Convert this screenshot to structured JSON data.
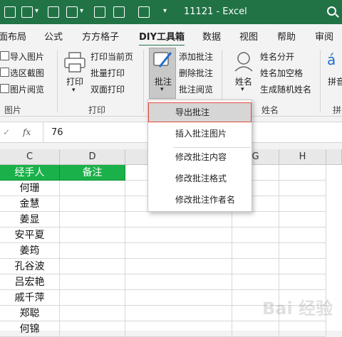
{
  "window": {
    "title": "11121  -  Excel"
  },
  "tabs": [
    "面布局",
    "公式",
    "方方格子",
    "DIY工具箱",
    "数据",
    "视图",
    "帮助",
    "审阅"
  ],
  "ribbon": {
    "picture_group": {
      "items": [
        "导入图片",
        "选区截图",
        "图片阅览"
      ],
      "label": "图片"
    },
    "print_group": {
      "big_label": "打印",
      "items": [
        "打印当前页",
        "批量打印",
        "双面打印"
      ],
      "label": "打印"
    },
    "comment_group": {
      "big_label": "批注",
      "items": [
        "添加批注",
        "删除批注",
        "批注阅览"
      ]
    },
    "name_group": {
      "big_label": "姓名",
      "items": [
        "姓名分开",
        "姓名加空格",
        "生成随机姓名"
      ],
      "label": "姓名"
    },
    "pinyin_group": {
      "big_label": "拼音",
      "label": "拼"
    }
  },
  "formula_bar": {
    "fx": "fx",
    "value": "76"
  },
  "grid": {
    "columns": [
      "C",
      "D",
      "",
      "G",
      "H"
    ],
    "header_row": [
      "经手人",
      "备注"
    ],
    "rows": [
      "何珊",
      "金慧",
      "姜显",
      "安平夏",
      "姜筠",
      "孔谷波",
      "吕宏艳",
      "戚千萍",
      "郑聪",
      "何锦"
    ]
  },
  "dropdown": {
    "items": [
      "导出批注",
      "插入批注图片",
      "修改批注内容",
      "修改批注格式",
      "修改批注作者名"
    ]
  },
  "watermark": "Bai 经验"
}
